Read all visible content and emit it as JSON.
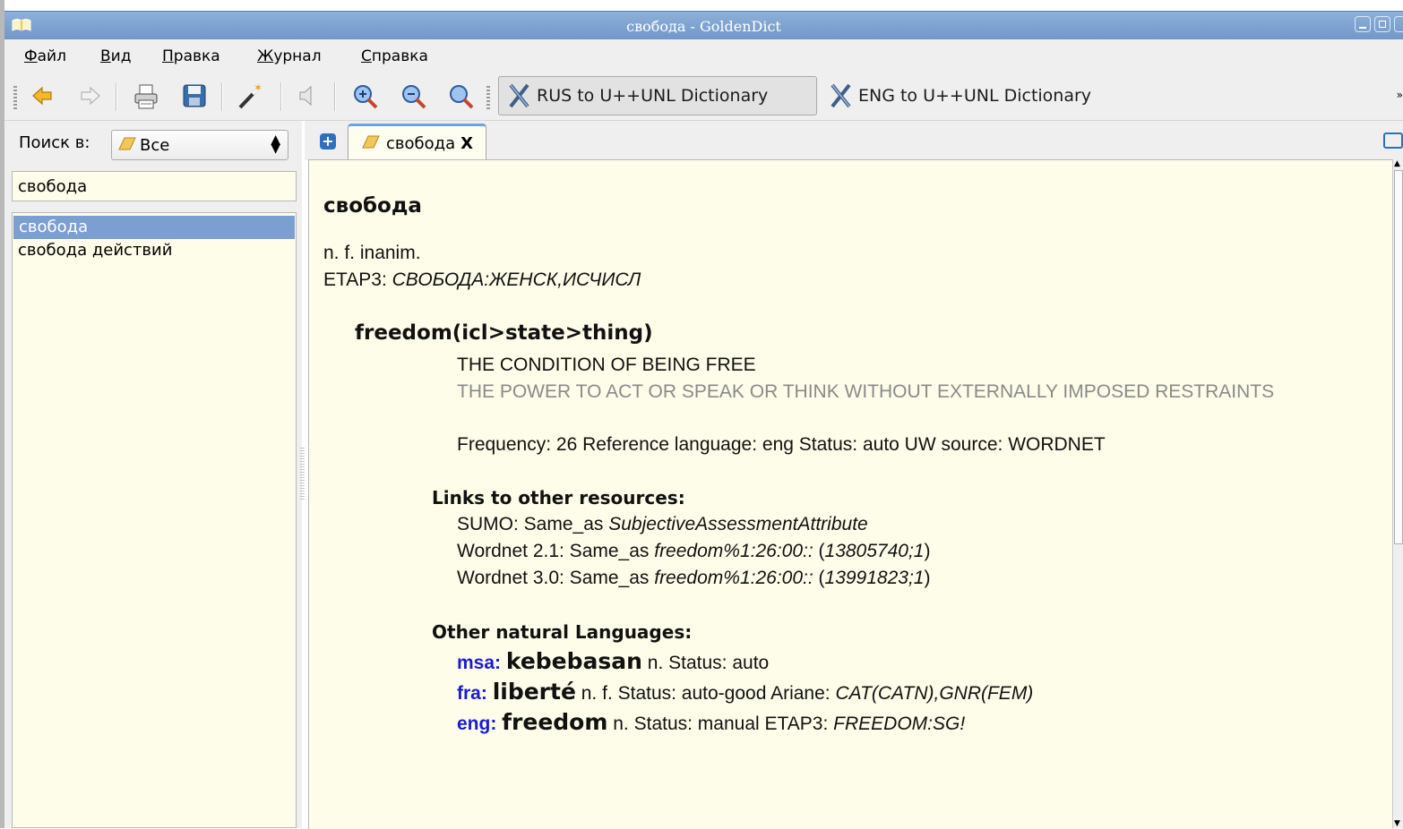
{
  "window": {
    "title": "свобода - GoldenDict"
  },
  "menu": {
    "items": [
      {
        "mnemonic": "Ф",
        "rest": "айл"
      },
      {
        "mnemonic": "В",
        "rest": "ид"
      },
      {
        "mnemonic": "П",
        "rest": "равка"
      },
      {
        "mnemonic": "Ж",
        "rest": "урнал"
      },
      {
        "mnemonic": "С",
        "rest": "правка"
      }
    ]
  },
  "toolbar": {
    "icons": [
      "back-arrow-icon",
      "forward-arrow-icon",
      "print-icon",
      "save-icon",
      "magic-wand-icon",
      "speaker-icon",
      "zoom-in-icon",
      "zoom-out-icon",
      "zoom-reset-icon"
    ],
    "dictionaries": [
      {
        "label": "RUS to U++UNL Dictionary",
        "active": true
      },
      {
        "label": "ENG to U++UNL Dictionary",
        "active": false
      }
    ]
  },
  "left": {
    "search_in_label": "Поиск в:",
    "group_value": "Все",
    "search_value": "свобода",
    "words": [
      "свобода",
      "свобода действий"
    ],
    "selected_index": 0
  },
  "tabs": [
    {
      "label": "свобода",
      "close": "X"
    }
  ],
  "article": {
    "headword": "свобода",
    "grammar": "n. f. inanim.",
    "etap_prefix": "ETAP3: ",
    "etap_value": "СВОБОДА:ЖЕНСК,ИСЧИСЛ",
    "uw": "freedom(icl>state>thing)",
    "definition_1": "THE CONDITION OF BEING FREE",
    "definition_2": "THE POWER TO ACT OR SPEAK OR THINK WITHOUT EXTERNALLY IMPOSED RESTRAINTS",
    "info": "Frequency: 26 Reference language: eng Status: auto UW source: WORDNET",
    "links_title": "Links to other resources:",
    "links": [
      {
        "prefix": "SUMO: Same_as ",
        "target": "SubjectiveAssessmentAttribute",
        "open": "",
        "id": "",
        "close": ""
      },
      {
        "prefix": "Wordnet 2.1: Same_as ",
        "target": "freedom%1:26:00::",
        "open": " (",
        "id": "13805740;1",
        "close": ")"
      },
      {
        "prefix": "Wordnet 3.0: Same_as ",
        "target": "freedom%1:26:00::",
        "open": " (",
        "id": "13991823;1",
        "close": ")"
      }
    ],
    "langs_title": "Other natural Languages:",
    "languages": [
      {
        "code": "msa:",
        "word": "kebebasan",
        "rest": " n. Status: auto",
        "extra": ""
      },
      {
        "code": "fra:",
        "word": "liberté",
        "rest": " n. f. Status: auto-good Ariane: ",
        "extra": "CAT(CATN),GNR(FEM)"
      },
      {
        "code": "eng:",
        "word": "freedom",
        "rest": " n. Status: manual ETAP3: ",
        "extra": "FREEDOM:SG!"
      }
    ]
  }
}
